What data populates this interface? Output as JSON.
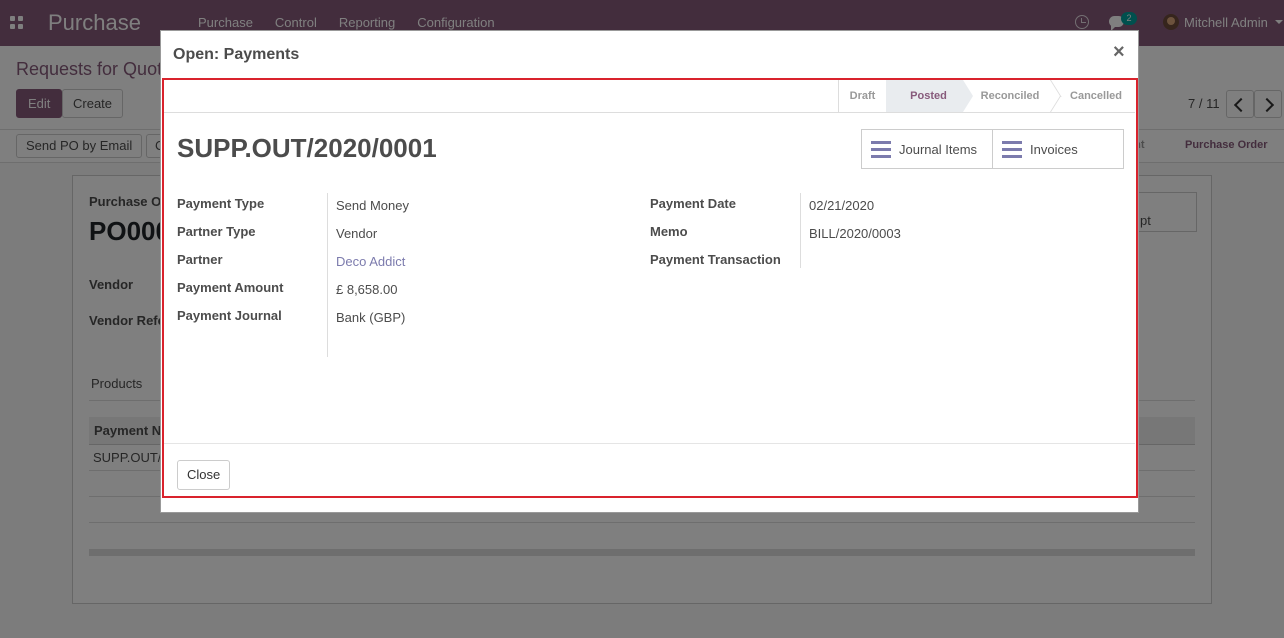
{
  "navbar": {
    "app_title": "Purchase",
    "menu": [
      "Purchase",
      "Control",
      "Reporting",
      "Configuration"
    ],
    "chat_count": "2",
    "user": "Mitchell Admin",
    "accent": "#875a7b"
  },
  "background": {
    "breadcrumb": "Requests for Quot",
    "edit_label": "Edit",
    "create_label": "Create",
    "pager": "7 / 11",
    "send_po_label": "Send PO by Email",
    "second_button": "C",
    "stage_partial": "ent",
    "stage_purchase_order": "Purchase Order",
    "sheet": {
      "doc_label": "Purchase O",
      "doc_title": "PO000",
      "vendor_label": "Vendor",
      "vendor_ref_label": "Vendor Refe",
      "receipt_btn": "pt",
      "tab_products": "Products",
      "table_header": "Payment N",
      "table_row": "SUPP.OUT/"
    }
  },
  "modal": {
    "title": "Open: Payments",
    "close_symbol": "×",
    "stages": [
      {
        "label": "Draft",
        "active": false
      },
      {
        "label": "Posted",
        "active": true
      },
      {
        "label": "Reconciled",
        "active": false
      },
      {
        "label": "Cancelled",
        "active": false
      }
    ],
    "payment_name": "SUPP.OUT/2020/0001",
    "smart_buttons": {
      "journal_items": "Journal Items",
      "invoices": "Invoices"
    },
    "left_fields": [
      {
        "label": "Payment Type",
        "value": "Send Money"
      },
      {
        "label": "Partner Type",
        "value": "Vendor"
      },
      {
        "label": "Partner",
        "value": "Deco Addict"
      },
      {
        "label": "Payment Amount",
        "value": "£ 8,658.00"
      },
      {
        "label": "Payment Journal",
        "value": "Bank (GBP)"
      }
    ],
    "right_fields": [
      {
        "label": "Payment Date",
        "value": "02/21/2020"
      },
      {
        "label": "Memo",
        "value": "BILL/2020/0003"
      },
      {
        "label": "Payment Transaction",
        "value": ""
      }
    ],
    "close_button": "Close",
    "highlight_color": "#d9232d"
  }
}
